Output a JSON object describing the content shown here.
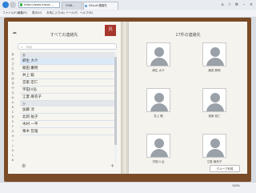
{
  "browser": {
    "url": "https://www.icloud....",
    "tabs": [
      "iOS8...",
      "iCloud 連絡先"
    ],
    "menu": [
      "ファイル(F)",
      "編集(E)",
      "表示(V)",
      "お気に入り(A)",
      "ツール(T)",
      "ヘルプ(H)"
    ],
    "zoom": "100%"
  },
  "left": {
    "title": "すべての連絡先",
    "ribbon": "汎",
    "search_placeholder": "検索",
    "alphabet": [
      "あ",
      "か",
      "さ",
      "た",
      "な",
      "は",
      "ま",
      "や",
      "ら",
      "わ",
      "A",
      "B",
      "C",
      "D",
      "E",
      "F",
      "G",
      "H",
      "I",
      "J",
      "K",
      "L",
      "#"
    ],
    "sections": [
      {
        "label": "あ",
        "rows": [
          "麻生 大介",
          "飯田 慶明",
          "井上 聡",
          "宮家 宏仁",
          "宇田川弘",
          "江夏 麻衣子"
        ]
      },
      {
        "label": "か",
        "rows": [
          "加藤 淳",
          "北岡 祐子",
          "木村 一平",
          "栗木 哲雄"
        ]
      }
    ],
    "selected_index": 0
  },
  "right": {
    "title": "17件の連絡先",
    "contacts": [
      "麻生 大介",
      "飯田 慶明",
      "井上 聡",
      "宮家 宏仁",
      "宇田川 弘",
      "江夏 麻衣子"
    ],
    "group_button": "グループ作成"
  }
}
